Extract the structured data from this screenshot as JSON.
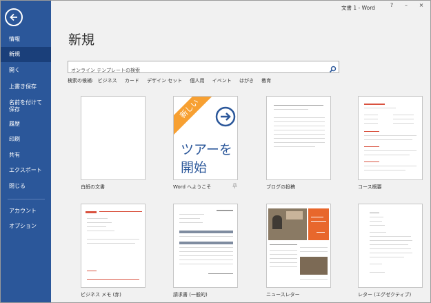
{
  "window": {
    "title": "文書 1 - Word"
  },
  "sidebar": {
    "items": [
      {
        "label": "情報"
      },
      {
        "label": "新規"
      },
      {
        "label": "開く"
      },
      {
        "label": "上書き保存"
      },
      {
        "label": "名前を付けて"
      },
      {
        "label": "保存"
      },
      {
        "label": "履歴"
      },
      {
        "label": "印刷"
      },
      {
        "label": "共有"
      },
      {
        "label": "エクスポート"
      },
      {
        "label": "閉じる"
      },
      {
        "label": "アカウント"
      },
      {
        "label": "オプション"
      }
    ],
    "active": "新規"
  },
  "main": {
    "heading": "新規",
    "search": {
      "placeholder": "オンライン テンプレートの検索",
      "value": ""
    },
    "suggested_label": "検索の候補:",
    "suggested": [
      "ビジネス",
      "カード",
      "デザイン セット",
      "個人用",
      "イベント",
      "はがき",
      "教育"
    ],
    "templates": [
      {
        "label": "白紙の文書"
      },
      {
        "label": "Word へようこそ",
        "ribbon": "新しい",
        "body": "ツアーを",
        "body2": "開始"
      },
      {
        "label": "ブログの投稿"
      },
      {
        "label": "コース概要"
      },
      {
        "label": "ビジネス メモ (赤)"
      },
      {
        "label": "請求書 (一般的)"
      },
      {
        "label": "ニュースレター"
      },
      {
        "label": "レター (エグゼクティブ)"
      }
    ]
  },
  "colors": {
    "sidebar": "#2b579a",
    "sidebar_active": "#1a3f7a",
    "accent_orange": "#f7a032",
    "accent_blue": "#2b579a"
  },
  "icons": {
    "back": "back-arrow-icon",
    "search": "magnifier-icon",
    "pin": "pin-icon",
    "tour": "arrow-circle-icon"
  }
}
